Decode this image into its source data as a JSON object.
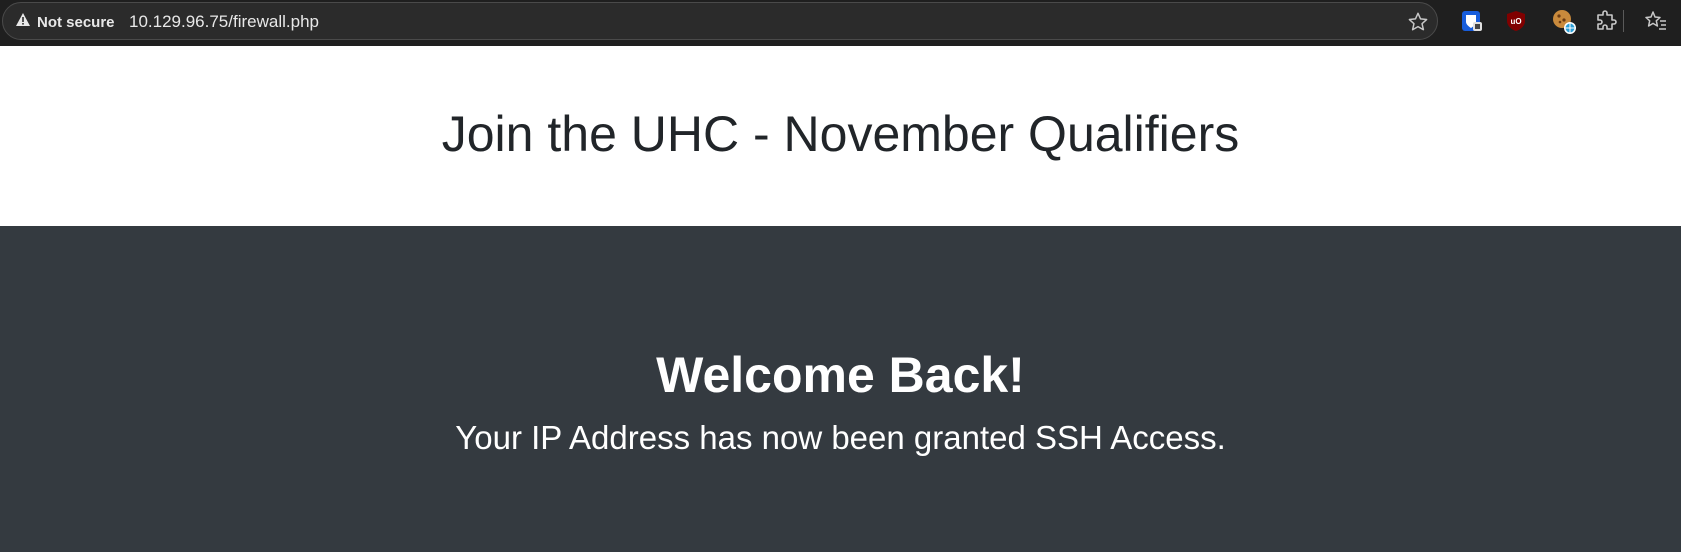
{
  "browser": {
    "security_label": "Not secure",
    "url": "10.129.96.75/firewall.php",
    "icons": [
      "warning-icon",
      "bookmark-star-icon",
      "bitwarden-extension-icon",
      "ublock-origin-extension-icon",
      "cookie-extension-icon",
      "extensions-puzzle-icon",
      "reading-list-icon"
    ]
  },
  "page": {
    "title": "Join the UHC - November Qualifiers",
    "hero": {
      "heading": "Welcome Back!",
      "subheading": "Your IP Address has now been granted SSH Access."
    }
  },
  "colors": {
    "browser_bar": "#1f1f1f",
    "omnibox": "#2b2b2b",
    "hero_background": "#343a40",
    "title_text": "#212529"
  }
}
